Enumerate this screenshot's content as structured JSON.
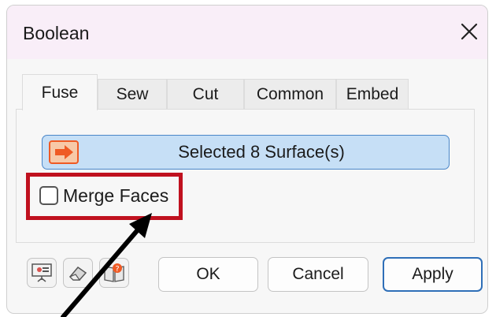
{
  "dialog": {
    "title": "Boolean",
    "close_icon": "close-icon"
  },
  "tabs": [
    {
      "label": "Fuse",
      "active": true
    },
    {
      "label": "Sew",
      "active": false
    },
    {
      "label": "Cut",
      "active": false
    },
    {
      "label": "Common",
      "active": false
    },
    {
      "label": "Embed",
      "active": false
    }
  ],
  "selection": {
    "label": "Selected 8 Surface(s)",
    "icon": "selection-arrow-icon"
  },
  "merge_faces": {
    "label": "Merge Faces",
    "checked": false
  },
  "footer": {
    "icons": [
      "presentation-icon",
      "eraser-icon",
      "help-book-icon"
    ],
    "ok_label": "OK",
    "cancel_label": "Cancel",
    "apply_label": "Apply"
  },
  "colors": {
    "title_bar": "#f9eef8",
    "selection_fill": "#c6dff6",
    "selection_border": "#4a86c8",
    "highlight": "#c0111f",
    "apply_border": "#2f6fb8",
    "icon_orange": "#ef5a24"
  }
}
